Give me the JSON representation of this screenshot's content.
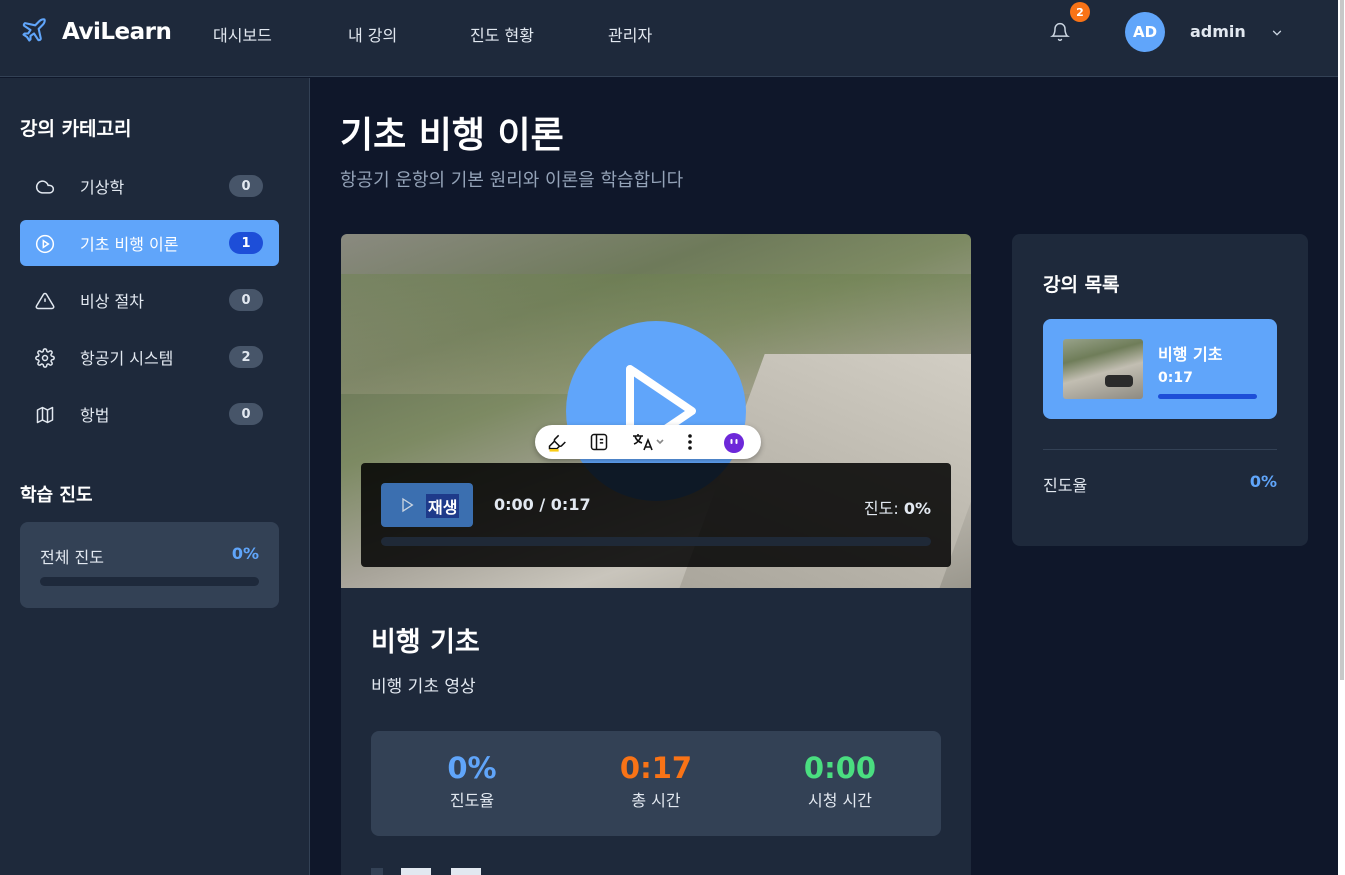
{
  "app": {
    "name": "AviLearn",
    "brand_color": "#60a5fa"
  },
  "nav": {
    "links": [
      "대시보드",
      "내 강의",
      "진도 현황",
      "관리자"
    ],
    "notifications": {
      "count": "2",
      "icon": "bell-icon"
    },
    "user": {
      "initials": "AD",
      "name": "admin"
    }
  },
  "sidebar": {
    "title": "강의 카테고리",
    "categories": [
      {
        "label": "기상학",
        "count": "0",
        "icon": "cloud-icon",
        "active": false
      },
      {
        "label": "기초 비행 이론",
        "count": "1",
        "icon": "play-circle-icon",
        "active": true
      },
      {
        "label": "비상 절차",
        "count": "0",
        "icon": "warning-icon",
        "active": false
      },
      {
        "label": "항공기 시스템",
        "count": "2",
        "icon": "gear-icon",
        "active": false
      },
      {
        "label": "항법",
        "count": "0",
        "icon": "map-icon",
        "active": false
      }
    ],
    "progress": {
      "title": "학습 진도",
      "label": "전체 진도",
      "value": "0%",
      "fraction": 0
    }
  },
  "main": {
    "title": "기초 비행 이론",
    "subtitle": "항공기 운항의 기본 원리와 이론을 학습합니다",
    "player": {
      "play_label": "재생",
      "time": "0:00 / 0:17",
      "progress_label": "진도:",
      "progress_value": "0%",
      "progress_fraction": 0
    },
    "lesson": {
      "title": "비행 기초",
      "description": "비행 기초 영상",
      "stats": [
        {
          "value": "0%",
          "label": "진도율",
          "color": "#60a5fa"
        },
        {
          "value": "0:17",
          "label": "총 시간",
          "color": "#f97316"
        },
        {
          "value": "0:00",
          "label": "시청 시간",
          "color": "#4ade80"
        }
      ]
    }
  },
  "lecture_list": {
    "title": "강의 목록",
    "items": [
      {
        "title": "비행 기초",
        "duration": "0:17",
        "active": true
      }
    ],
    "progress_label": "진도율",
    "progress_value": "0%"
  }
}
